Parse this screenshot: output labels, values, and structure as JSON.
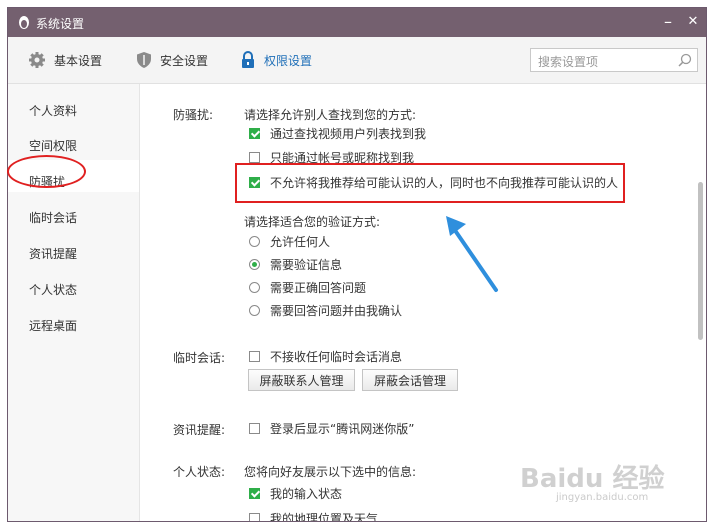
{
  "window": {
    "title": "系统设置",
    "minimize": "–",
    "close": "✕"
  },
  "toolbar": {
    "tabs": [
      {
        "label": "基本设置",
        "icon": "gear-icon"
      },
      {
        "label": "安全设置",
        "icon": "shield-icon"
      },
      {
        "label": "权限设置",
        "icon": "lock-icon",
        "active": true
      }
    ],
    "search_placeholder": "搜索设置项"
  },
  "sidebar": {
    "items": [
      "个人资料",
      "空间权限",
      "防骚扰",
      "临时会话",
      "资讯提醒",
      "个人状态",
      "远程桌面"
    ],
    "selected": "防骚扰"
  },
  "anti_harass": {
    "section_label": "防骚扰:",
    "find_prompt": "请选择允许别人查找到您的方式:",
    "find_options": [
      {
        "label": "通过查找视频用户列表找到我",
        "checked": true
      },
      {
        "label": "只能通过帐号或昵称找到我",
        "checked": false
      },
      {
        "label": "不允许将我推荐给可能认识的人，同时也不向我推荐可能认识的人",
        "checked": true
      }
    ],
    "verify_prompt": "请选择适合您的验证方式:",
    "verify_options": [
      {
        "label": "允许任何人",
        "selected": false
      },
      {
        "label": "需要验证信息",
        "selected": true
      },
      {
        "label": "需要正确回答问题",
        "selected": false
      },
      {
        "label": "需要回答问题并由我确认",
        "selected": false
      }
    ]
  },
  "temp_session": {
    "section_label": "临时会话:",
    "option": {
      "label": "不接收任何临时会话消息",
      "checked": false
    },
    "buttons": [
      "屏蔽联系人管理",
      "屏蔽会话管理"
    ]
  },
  "news": {
    "section_label": "资讯提醒:",
    "option": {
      "label": "登录后显示“腾讯网迷你版”",
      "checked": false
    }
  },
  "status": {
    "section_label": "个人状态:",
    "prompt": "您将向好友展示以下选中的信息:",
    "options": [
      {
        "label": "我的输入状态",
        "checked": true
      },
      {
        "label": "我的地理位置及天气",
        "checked": false
      }
    ]
  },
  "colors": {
    "titlebar": "#74606f",
    "active_tab": "#1f6fb8",
    "check": "#2fae49",
    "highlight": "#e02020",
    "arrow": "#2f8fdd"
  },
  "watermark": {
    "text": "Baidu 经验",
    "sub": "jingyan.baidu.com"
  }
}
